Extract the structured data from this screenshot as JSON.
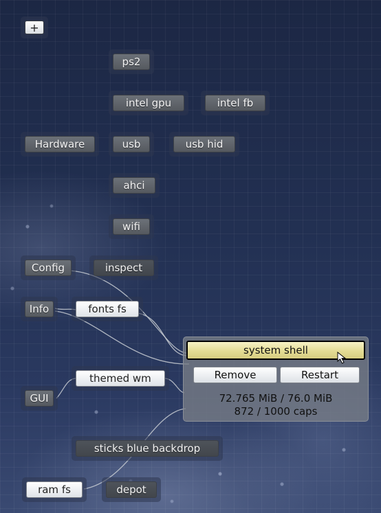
{
  "toolbar": {
    "add_label": "+"
  },
  "nodes": {
    "ps2": "ps2",
    "intel_gpu": "intel gpu",
    "intel_fb": "intel fb",
    "hardware": "Hardware",
    "usb": "usb",
    "usb_hid": "usb hid",
    "ahci": "ahci",
    "wifi": "wifi",
    "config": "Config",
    "inspect": "inspect",
    "info": "Info",
    "fonts_fs": "fonts fs",
    "themed_wm": "themed wm",
    "gui": "GUI",
    "sticks_blue_backdrop": "sticks blue backdrop",
    "ram_fs": "ram fs",
    "depot": "depot"
  },
  "popup": {
    "title": "system shell",
    "remove_label": "Remove",
    "restart_label": "Restart",
    "memory": "72.765 MiB / 76.0 MiB",
    "caps": "872 / 1000 caps"
  },
  "colors": {
    "background": "#223052",
    "node_button": "#5f6369",
    "selected_button": "#ffffff",
    "popup_title": "#e4dc95",
    "wire": "#c8ccd2"
  }
}
